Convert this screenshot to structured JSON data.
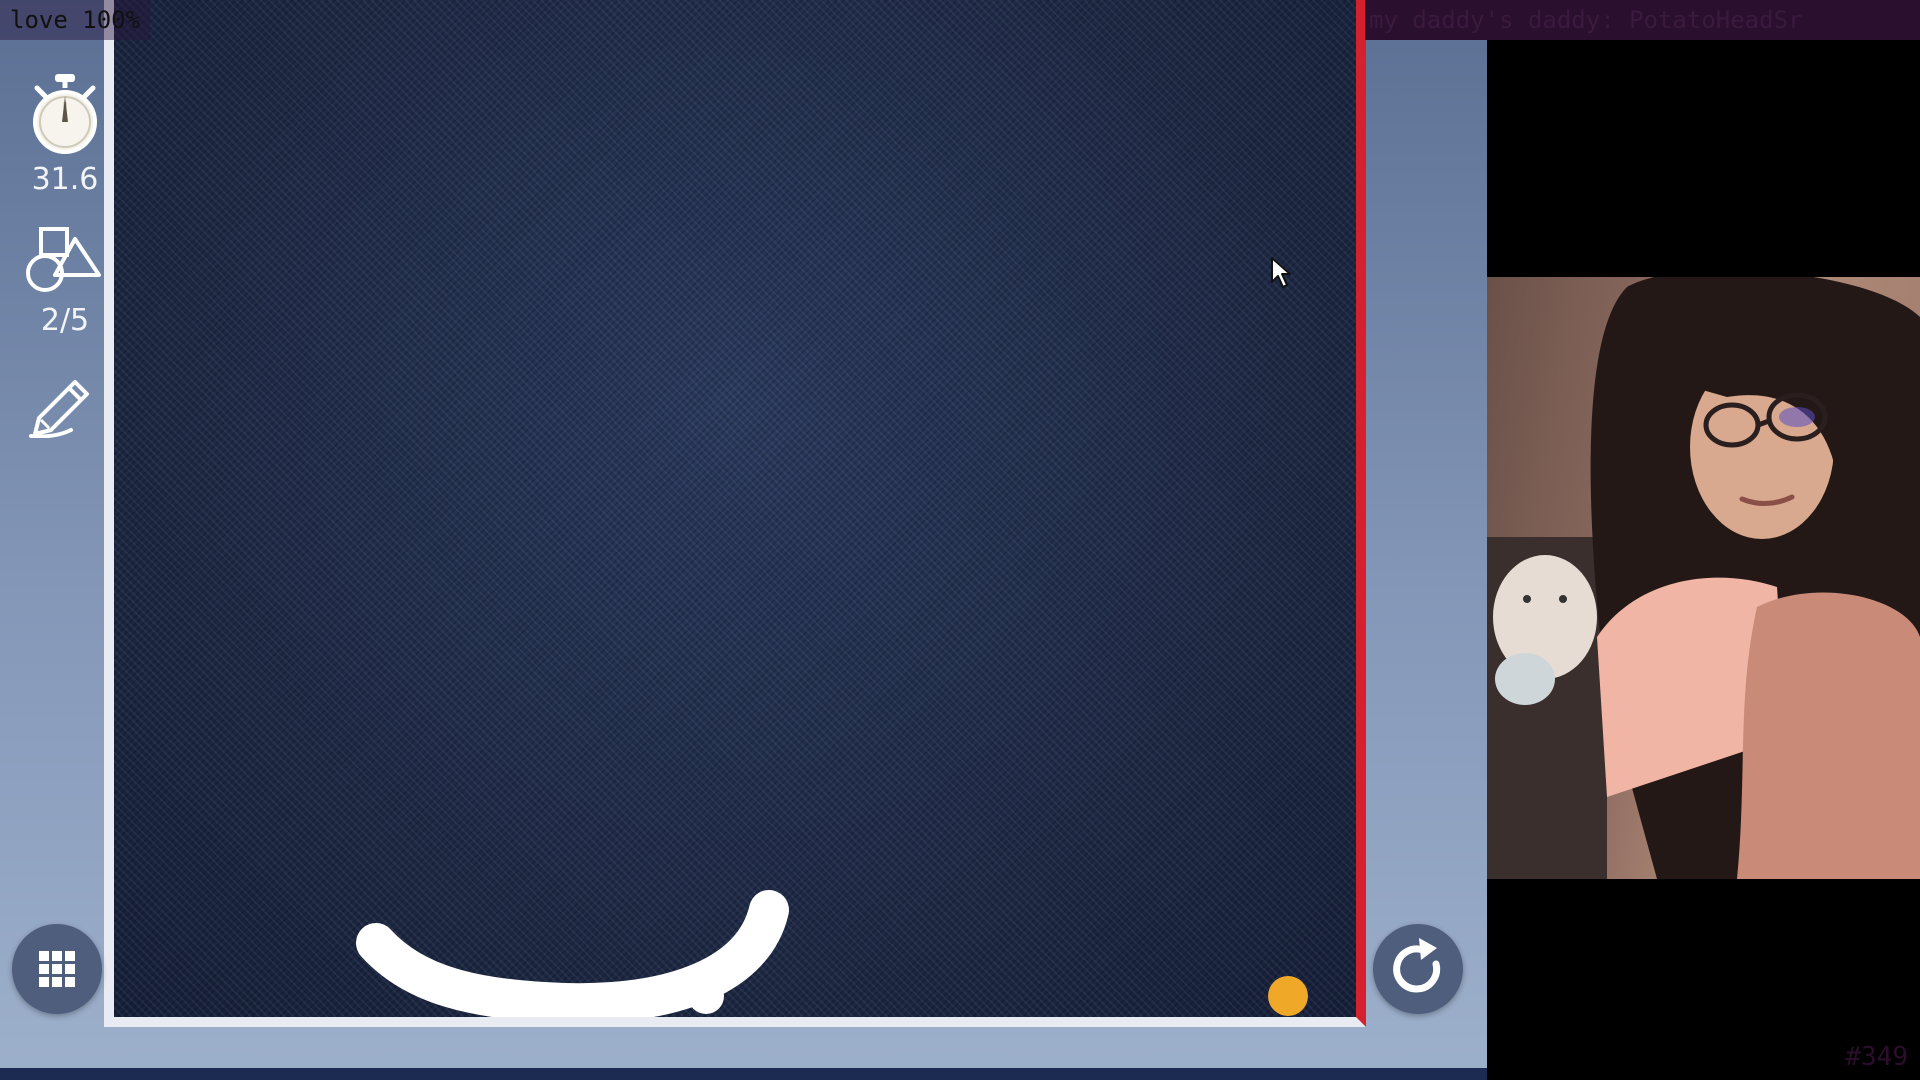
{
  "stream_overlay": {
    "top_left_text": "love 100%",
    "top_right_text": "my daddy's daddy: PotatoHeadSr",
    "counter_text": "#349"
  },
  "sidebar": {
    "timer": {
      "icon": "stopwatch-icon",
      "value": "31.6"
    },
    "shapes": {
      "icon": "shapes-icon",
      "value": "2/5"
    },
    "draw": {
      "icon": "pencil-icon"
    }
  },
  "buttons": {
    "level_select_icon": "grid-icon",
    "restart_icon": "restart-icon"
  },
  "colors": {
    "board_bg": "#1e2b47",
    "board_right_border": "#d4202f",
    "ball_orange": "#f0a829",
    "ball_white": "#ffffff",
    "stroke_white": "#ffffff"
  },
  "webcam": {
    "label": "streamer webcam"
  }
}
